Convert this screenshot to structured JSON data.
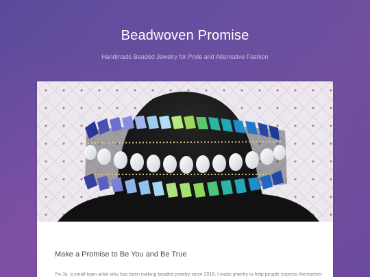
{
  "site": {
    "title": "Beadwoven Promise",
    "tagline": "Handmade Beaded Jewelry for Pride and Alternative Fashion"
  },
  "post": {
    "title": "Make a Promise to Be You and Be True",
    "excerpt": "I'm Jo, a small town artist who has been making beaded jewelry since 2018. I make jewelry to help people express themselves, whether it's"
  },
  "colors": {
    "background_start": "#5a4a9c",
    "background_end": "#7b4f98",
    "card": "#ffffff",
    "title_text": "#ffffff",
    "post_title": "#444a52"
  },
  "hero_image": {
    "subject": "beaded-choker-on-black-mannequin",
    "bead_colors": [
      "#3a3f9e",
      "#6b6fd0",
      "#8fc2ee",
      "#a6e070",
      "#2cb5a0",
      "#1e8ecf",
      "#2545a8"
    ]
  }
}
